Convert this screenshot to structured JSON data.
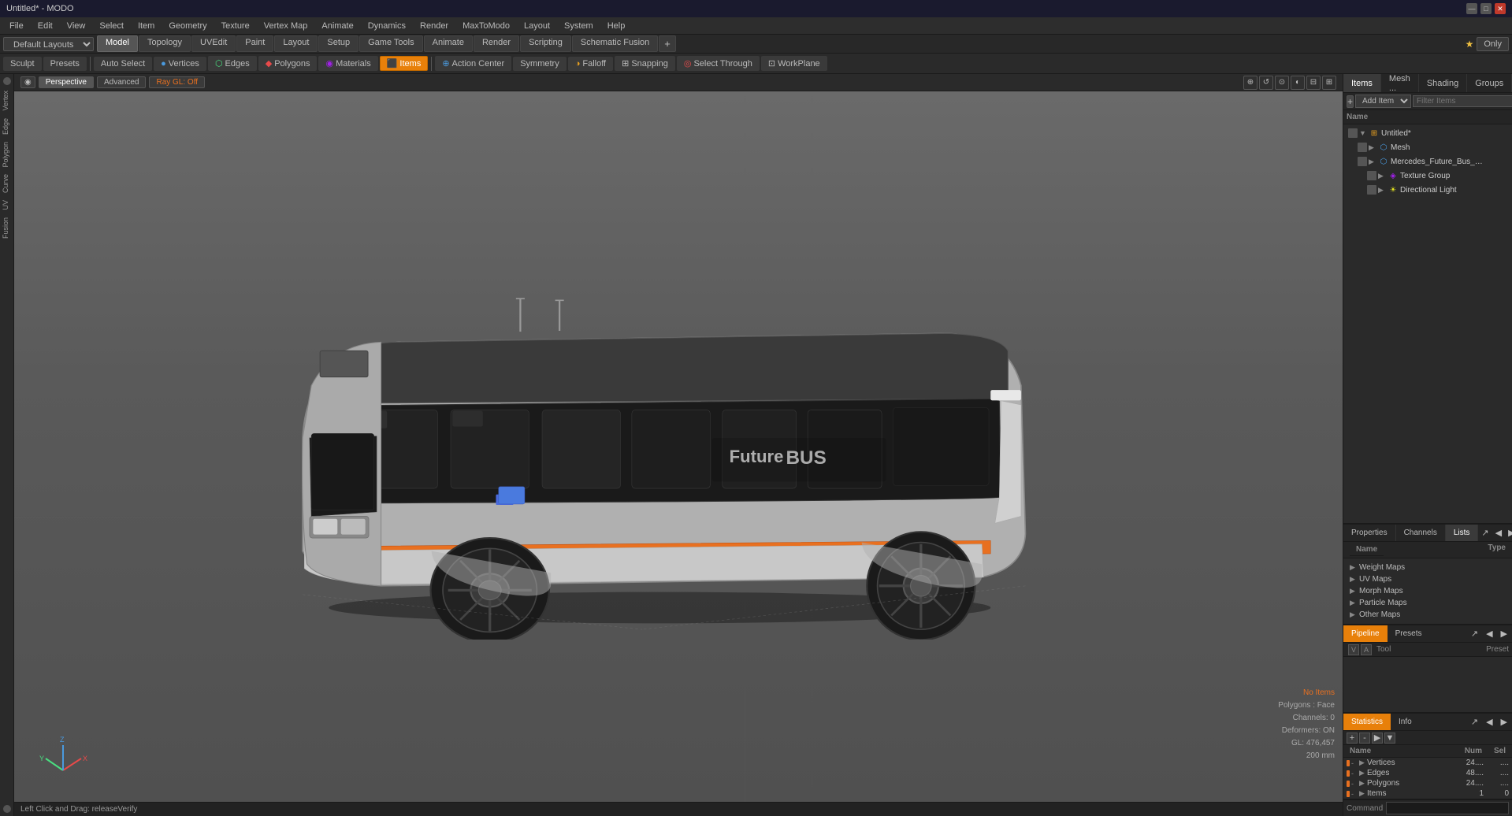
{
  "app": {
    "title": "Untitled* - MODO",
    "window_controls": [
      "—",
      "□",
      "✕"
    ]
  },
  "menubar": {
    "items": [
      "File",
      "Edit",
      "View",
      "Select",
      "Item",
      "Geometry",
      "Texture",
      "Vertex Map",
      "Animate",
      "Dynamics",
      "Render",
      "MaxToModo",
      "Layout",
      "System",
      "Help"
    ]
  },
  "layoutbar": {
    "dropdown_label": "Default Layouts",
    "tabs": [
      "Model",
      "Topology",
      "UVEdit",
      "Paint",
      "Layout",
      "Setup",
      "Game Tools",
      "Animate",
      "Render",
      "Scripting",
      "Schematic Fusion"
    ],
    "active_tab": "Model",
    "plus_label": "+",
    "star": "★",
    "only_btn": "Only"
  },
  "toolbar": {
    "sculpt_label": "Sculpt",
    "presets_label": "Presets",
    "auto_select_label": "Auto Select",
    "vertices_label": "Vertices",
    "edges_label": "Edges",
    "polygons_label": "Polygons",
    "materials_label": "Materials",
    "items_label": "Items",
    "action_center_label": "Action Center",
    "symmetry_label": "Symmetry",
    "falloff_label": "Falloff",
    "snapping_label": "Snapping",
    "select_through_label": "Select Through",
    "workplane_label": "WorkPlane"
  },
  "viewport": {
    "mode": "Perspective",
    "shading": "Advanced",
    "raygl": "Ray GL: Off",
    "controls": [
      "⊕",
      "↺",
      "⊘",
      "◐",
      "⊟",
      "⊞"
    ]
  },
  "right_panel": {
    "tabs": [
      "Items",
      "Mesh ...",
      "Shading",
      "Groups"
    ],
    "active_tab": "Items",
    "expand_icons": [
      "◀",
      "▶"
    ],
    "add_item_label": "Add Item",
    "filter_placeholder": "Filter Items",
    "tree_header": "Name",
    "tree": [
      {
        "level": 0,
        "expanded": true,
        "icon": "group",
        "label": "Untitled*",
        "starred": true
      },
      {
        "level": 1,
        "expanded": false,
        "icon": "mesh",
        "label": "Mesh"
      },
      {
        "level": 1,
        "expanded": true,
        "icon": "mesh",
        "label": "Mercedes_Future_Bus_Simple ...."
      },
      {
        "level": 2,
        "expanded": false,
        "icon": "texture",
        "label": "Texture Group"
      },
      {
        "level": 2,
        "expanded": false,
        "icon": "light",
        "label": "Directional Light"
      }
    ]
  },
  "bottom_panels": {
    "properties_tabs": [
      "Properties",
      "Channels",
      "Lists"
    ],
    "active_props_tab": "Lists",
    "lists_header": {
      "name": "Name",
      "type": "Type"
    },
    "lists": [
      {
        "label": "Weight Maps",
        "type": ""
      },
      {
        "label": "UV Maps",
        "type": ""
      },
      {
        "label": "Morph Maps",
        "type": ""
      },
      {
        "label": "Particle Maps",
        "type": ""
      },
      {
        "label": "Other Maps",
        "type": ""
      }
    ],
    "pipeline_tabs": [
      "Pipeline",
      "Presets"
    ],
    "active_pipeline_tab": "Pipeline",
    "pipeline_header": {
      "v": "V",
      "a": "A",
      "tool": "Tool",
      "preset": "Preset"
    },
    "stats_tabs": [
      "Statistics",
      "Info"
    ],
    "active_stats_tab": "Statistics",
    "stats_header": {
      "name": "Name",
      "num": "Num",
      "sel": "Sel"
    },
    "stats": [
      {
        "label": "Vertices",
        "num": "24....",
        "sel": "...."
      },
      {
        "label": "Edges",
        "num": "48....",
        "sel": "...."
      },
      {
        "label": "Polygons",
        "num": "24....",
        "sel": "...."
      },
      {
        "label": "Items",
        "num": "1",
        "sel": "0"
      }
    ]
  },
  "info_overlay": {
    "no_items": "No Items",
    "polygons_face": "Polygons : Face",
    "channels": "Channels: 0",
    "deformers": "Deformers: ON",
    "gl": "GL: 476,457",
    "size": "200 mm"
  },
  "statusbar": {
    "message": "Left Click and Drag:   releaseVerify"
  },
  "command_bar": {
    "label": "Command",
    "placeholder": ""
  }
}
